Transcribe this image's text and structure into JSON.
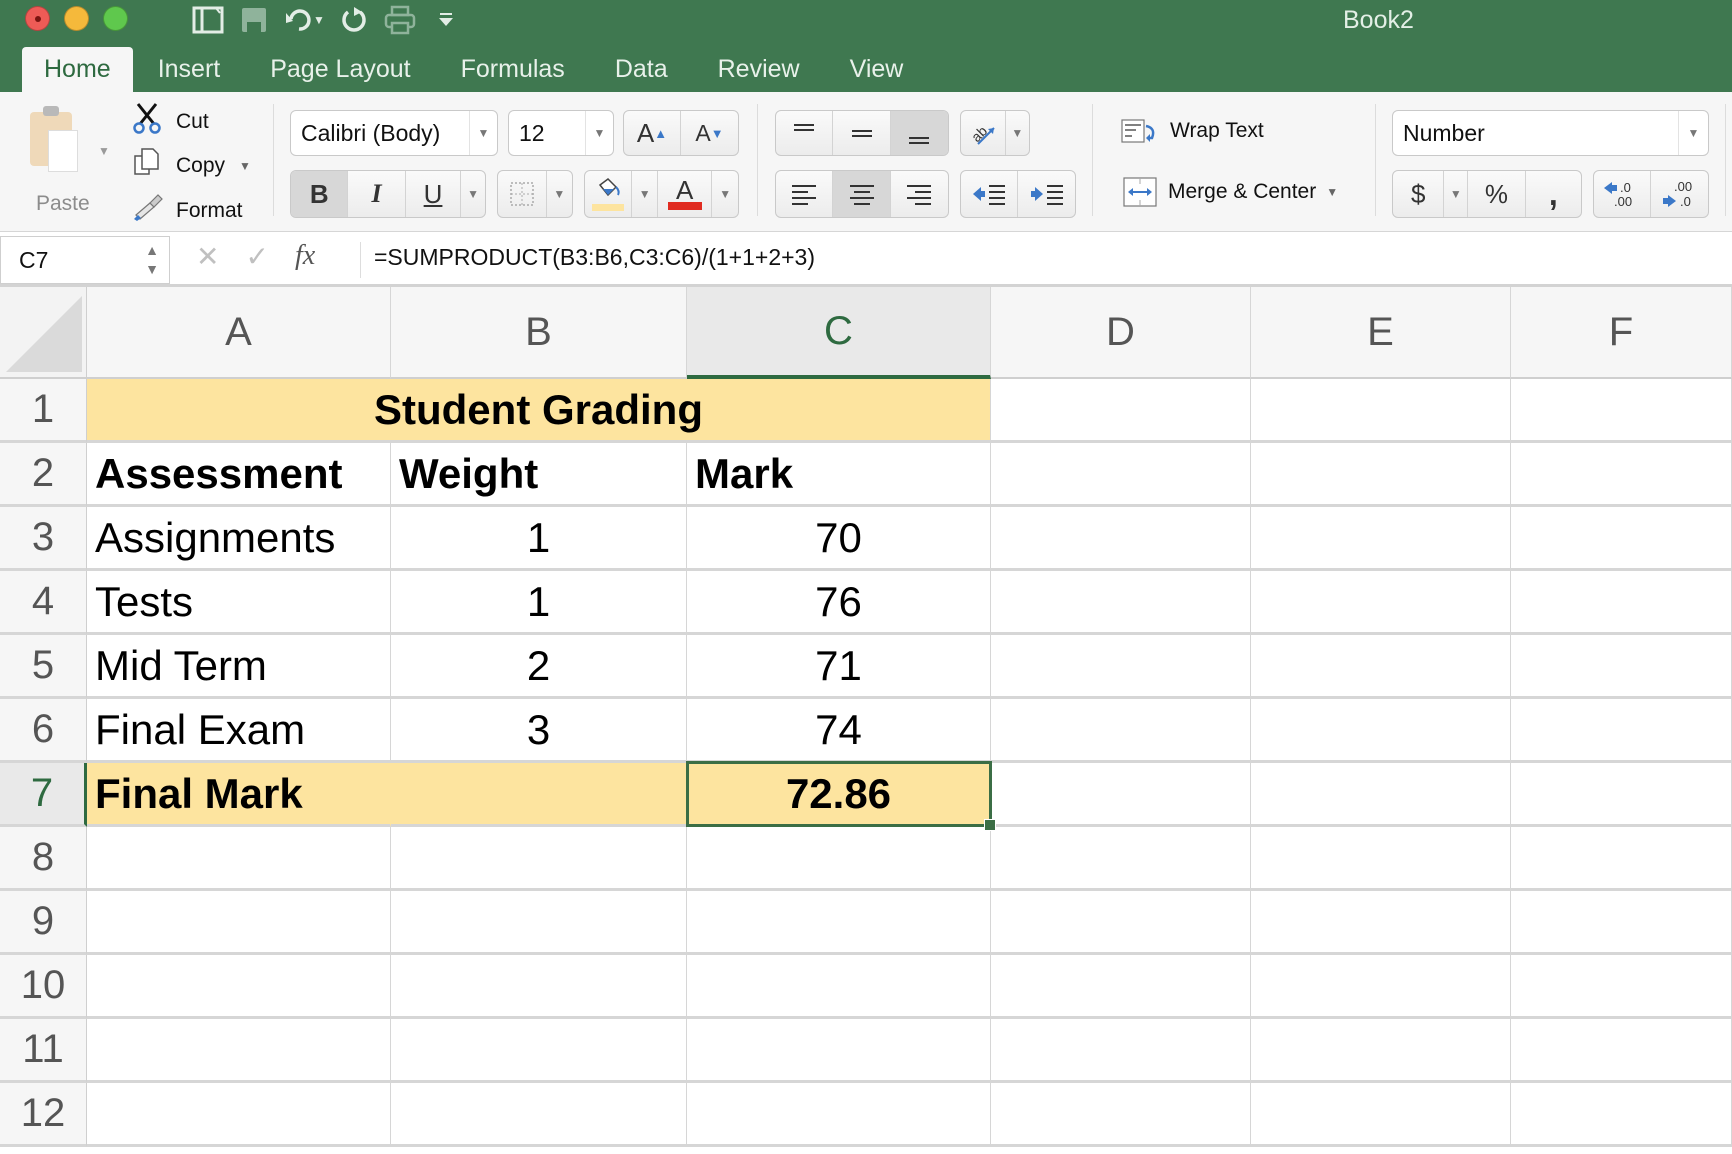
{
  "window": {
    "title": "Book2",
    "controls": [
      "close",
      "minimize",
      "maximize"
    ]
  },
  "quick_access": [
    {
      "name": "sidebar-toggle-icon",
      "glyph": "▯"
    },
    {
      "name": "save-icon",
      "glyph": "💾"
    },
    {
      "name": "undo-icon",
      "glyph": "↶"
    },
    {
      "name": "redo-icon",
      "glyph": "↻"
    },
    {
      "name": "print-icon",
      "glyph": "⎙"
    },
    {
      "name": "customize-toolbar-icon",
      "glyph": "⏷"
    }
  ],
  "tabs": [
    {
      "label": "Home",
      "active": true
    },
    {
      "label": "Insert",
      "active": false
    },
    {
      "label": "Page Layout",
      "active": false
    },
    {
      "label": "Formulas",
      "active": false
    },
    {
      "label": "Data",
      "active": false
    },
    {
      "label": "Review",
      "active": false
    },
    {
      "label": "View",
      "active": false
    }
  ],
  "ribbon": {
    "clipboard": {
      "paste_label": "Paste",
      "cut_label": "Cut",
      "copy_label": "Copy",
      "format_label": "Format"
    },
    "font": {
      "font_name": "Calibri (Body)",
      "font_size": "12",
      "increase_size": "A▴",
      "decrease_size": "A▾",
      "bold": "B",
      "italic": "I",
      "underline": "U",
      "font_color_glyph": "A",
      "fill_color": "#fde49f",
      "font_color": "#e02b20"
    },
    "alignment": {
      "wrap_text_label": "Wrap Text",
      "merge_center_label": "Merge & Center"
    },
    "number": {
      "format": "Number",
      "currency": "$",
      "percent": "%",
      "comma": ",",
      "increase_decimal": ".0 .00",
      "decrease_decimal": ".00 .0"
    }
  },
  "formula_bar": {
    "name_box": "C7",
    "cancel": "✕",
    "enter": "✓",
    "fx": "fx",
    "formula": "=SUMPRODUCT(B3:B6,C3:C6)/(1+1+2+3)"
  },
  "sheet": {
    "columns": [
      "A",
      "B",
      "C",
      "D",
      "E",
      "F"
    ],
    "selected_column": "C",
    "rows": [
      "1",
      "2",
      "3",
      "4",
      "5",
      "6",
      "7",
      "8",
      "9",
      "10",
      "11",
      "12"
    ],
    "selected_row": "7",
    "selected_cell": "C7",
    "highlight_color": "#fde49f",
    "title": "Student Grading",
    "headers": {
      "assessment": "Assessment",
      "weight": "Weight",
      "mark": "Mark"
    },
    "records": [
      {
        "assessment": "Assignments",
        "weight": "1",
        "mark": "70"
      },
      {
        "assessment": "Tests",
        "weight": "1",
        "mark": "76"
      },
      {
        "assessment": "Mid Term",
        "weight": "2",
        "mark": "71"
      },
      {
        "assessment": "Final Exam",
        "weight": "3",
        "mark": "74"
      }
    ],
    "final_label": "Final Mark",
    "final_value": "72.86"
  }
}
